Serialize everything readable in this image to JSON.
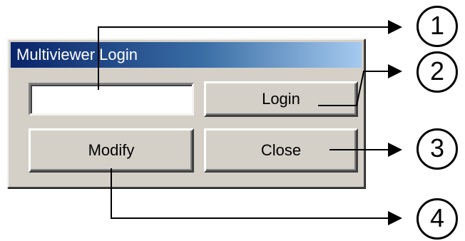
{
  "window": {
    "title": "Multiviewer Login"
  },
  "login_field": {
    "value": "",
    "placeholder": ""
  },
  "buttons": {
    "login": "Login",
    "close": "Close",
    "modify": "Modify"
  },
  "callouts": [
    "1",
    "2",
    "3",
    "4"
  ],
  "colors": {
    "title_gradient_start": "#0a246a",
    "title_gradient_end": "#a6caf0",
    "dialog_face": "#d4d0c8"
  }
}
